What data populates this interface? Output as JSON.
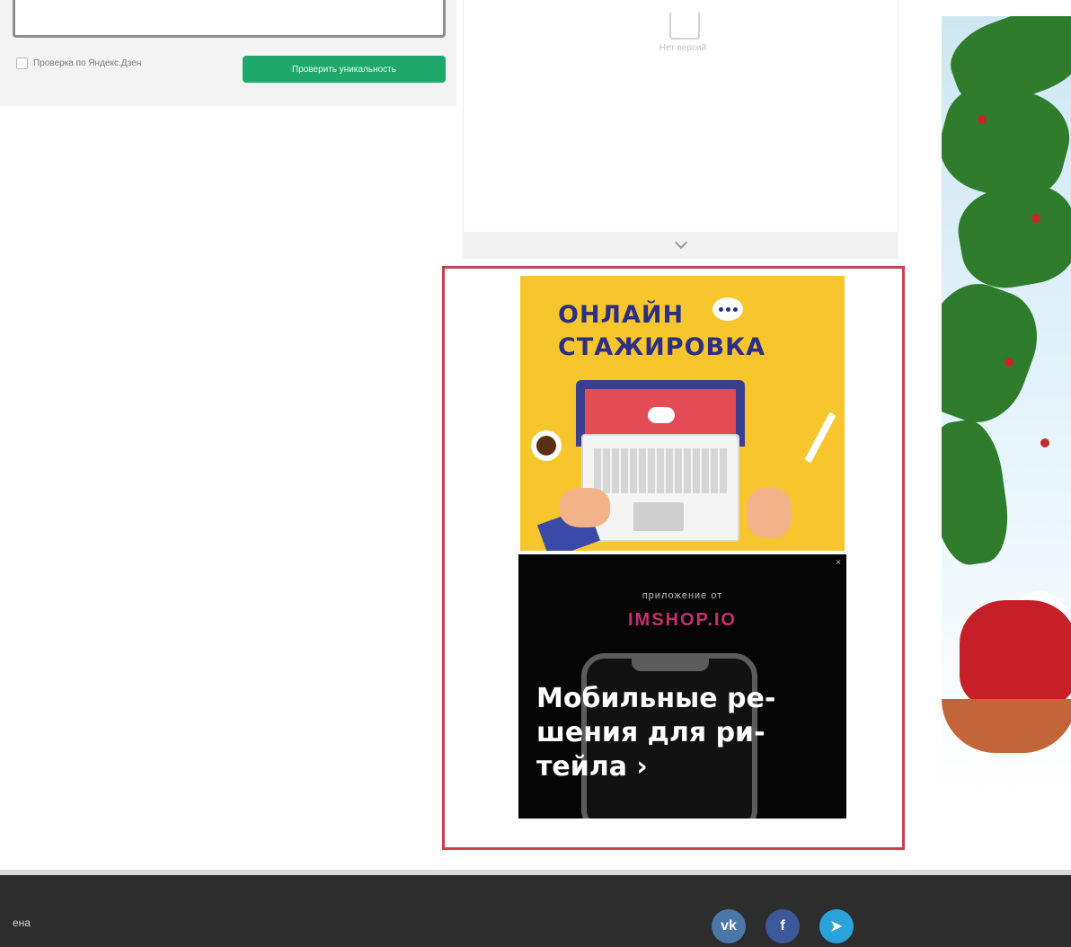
{
  "form": {
    "checkbox_label": "Проверка по Яндекс.Дзен",
    "check_button_label": "Проверить уникальность"
  },
  "versions": {
    "empty_text": "Нет версий"
  },
  "ad_top": {
    "title_line1": "ОНЛАЙН",
    "title_line2": "СТАЖИРОВКА"
  },
  "ad_bottom": {
    "close_label": "×",
    "subtitle": "приложение от",
    "brand": "IMSHOP.IO",
    "headline": "Мобильные ре-шения для ри-тейла ›"
  },
  "footer": {
    "left_text": "ена",
    "social": [
      {
        "label": "vk",
        "color": "#4a76a8"
      },
      {
        "label": "f",
        "color": "#3b5998"
      },
      {
        "label": "➤",
        "color": "#2aa3dd"
      }
    ]
  },
  "colors": {
    "accent_green": "#1fa86b",
    "ad_border": "#c9414a",
    "footer_bg": "#2d2d2d"
  }
}
